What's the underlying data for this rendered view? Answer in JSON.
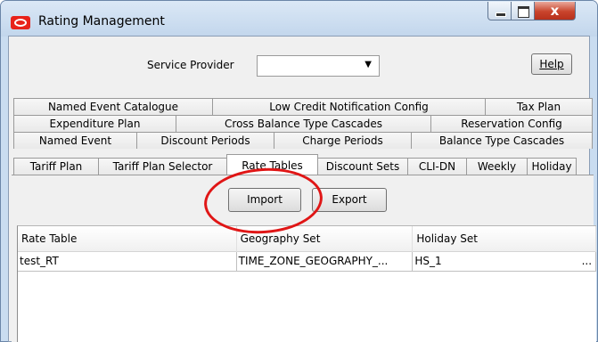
{
  "window": {
    "title": "Rating Management",
    "close_glyph": "x",
    "icons": {
      "app": "oracle-logo-icon",
      "minimize": "minimize-icon",
      "maximize": "maximize-icon",
      "close": "close-icon"
    }
  },
  "service_provider": {
    "label": "Service Provider",
    "value": "",
    "dropdown_icon": "chevron-down-icon"
  },
  "help_label": "Help",
  "tab_rows": [
    [
      "Named Event Catalogue",
      "Low Credit Notification Config",
      "Tax Plan"
    ],
    [
      "Expenditure Plan",
      "Cross Balance Type Cascades",
      "Reservation Config"
    ],
    [
      "Named Event",
      "Discount Periods",
      "Charge Periods",
      "Balance Type Cascades"
    ],
    [
      "Tariff Plan",
      "Tariff Plan Selector",
      "Rate Tables",
      "Discount Sets",
      "CLI-DN",
      "Weekly",
      "Holiday"
    ]
  ],
  "active_tab": "Rate Tables",
  "buttons": {
    "import": "Import",
    "export": "Export"
  },
  "table": {
    "columns": [
      "Rate Table",
      "Geography Set",
      "Holiday Set"
    ],
    "rows": [
      {
        "rate_table": "test_RT",
        "geography_set": "TIME_ZONE_GEOGRAPHY_...",
        "holiday_set": "HS_1",
        "more": "..."
      }
    ]
  },
  "colors": {
    "annotation_circle": "#e01616",
    "close_button": "#c9442c",
    "title_bar": "#c2d6ec"
  }
}
